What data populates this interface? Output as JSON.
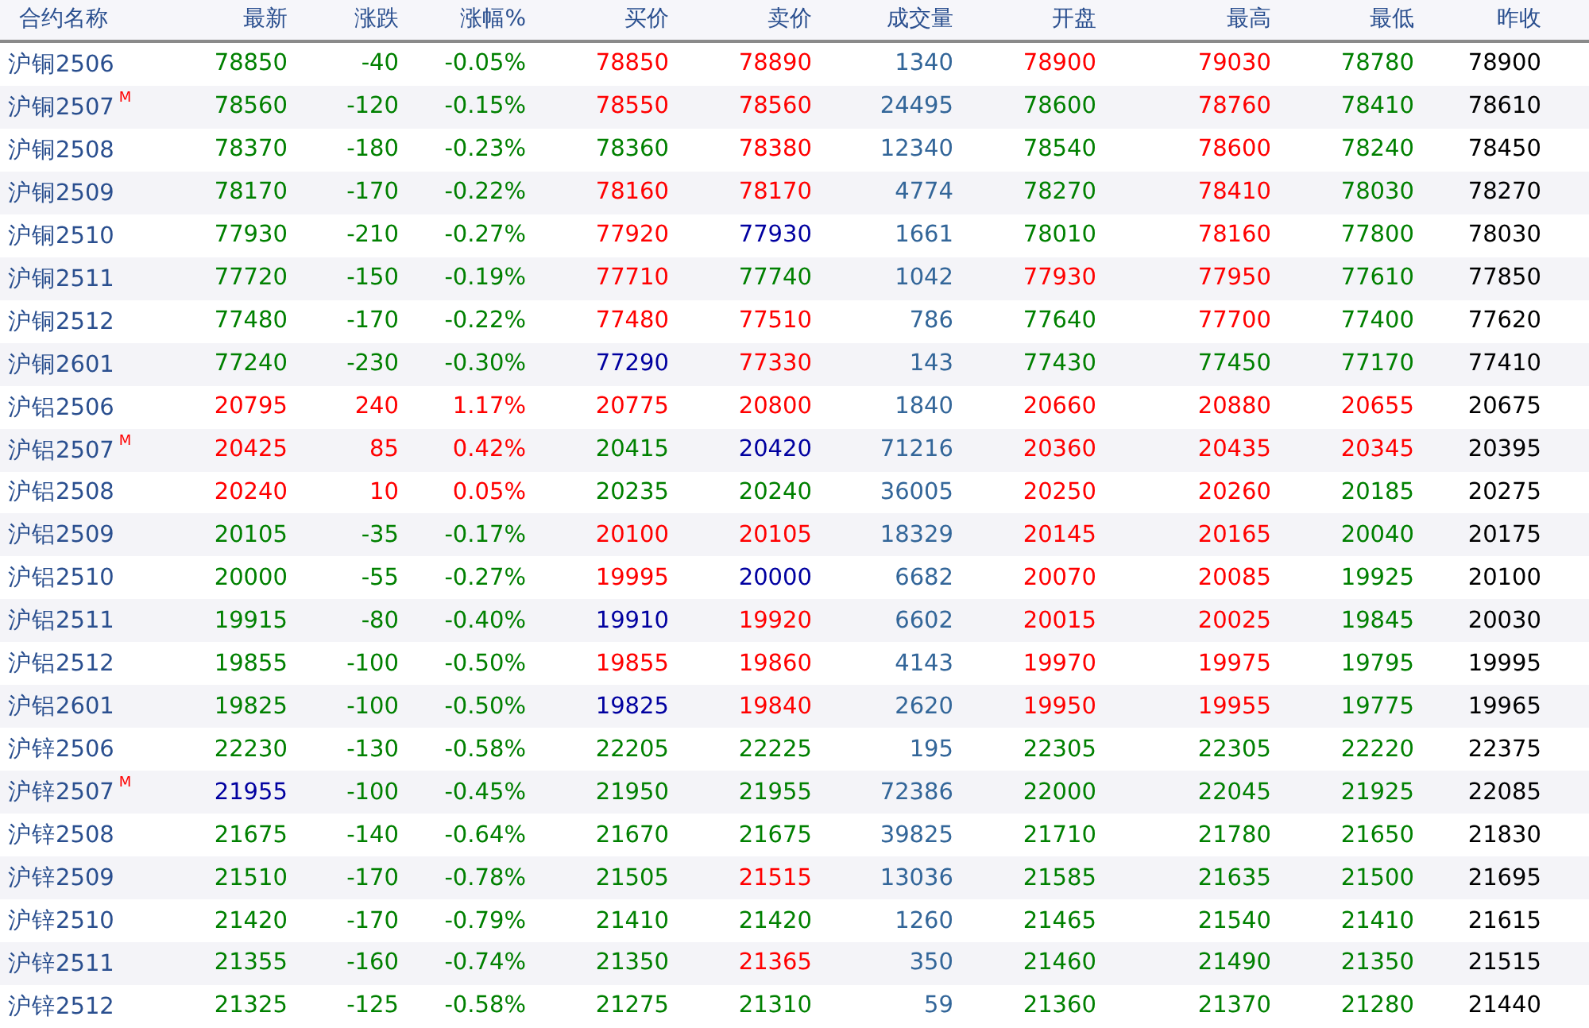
{
  "table": {
    "name_header": "合约名称",
    "columns": [
      "最新",
      "涨跌",
      "涨幅%",
      "买价",
      "卖价",
      "成交量",
      "开盘",
      "最高",
      "最低",
      "昨收"
    ],
    "rows": [
      {
        "name": "沪铜2506",
        "cells": [
          {
            "text": "78850",
            "color": "#008000"
          },
          {
            "text": "-40",
            "color": "#008000"
          },
          {
            "text": "-0.05%",
            "color": "#008000"
          },
          {
            "text": "78850",
            "color": "#ff0000"
          },
          {
            "text": "78890",
            "color": "#ff0000"
          },
          {
            "text": "1340",
            "color": "#336699"
          },
          {
            "text": "78900",
            "color": "#ff0000"
          },
          {
            "text": "79030",
            "color": "#ff0000"
          },
          {
            "text": "78780",
            "color": "#008000"
          },
          {
            "text": "78900",
            "color": "#000000"
          }
        ]
      },
      {
        "name": "沪铜2507",
        "badge": "M",
        "cells": [
          {
            "text": "78560",
            "color": "#008000"
          },
          {
            "text": "-120",
            "color": "#008000"
          },
          {
            "text": "-0.15%",
            "color": "#008000"
          },
          {
            "text": "78550",
            "color": "#ff0000"
          },
          {
            "text": "78560",
            "color": "#ff0000"
          },
          {
            "text": "24495",
            "color": "#336699"
          },
          {
            "text": "78600",
            "color": "#008000"
          },
          {
            "text": "78760",
            "color": "#ff0000"
          },
          {
            "text": "78410",
            "color": "#008000"
          },
          {
            "text": "78610",
            "color": "#000000"
          }
        ]
      },
      {
        "name": "沪铜2508",
        "cells": [
          {
            "text": "78370",
            "color": "#008000"
          },
          {
            "text": "-180",
            "color": "#008000"
          },
          {
            "text": "-0.23%",
            "color": "#008000"
          },
          {
            "text": "78360",
            "color": "#008000"
          },
          {
            "text": "78380",
            "color": "#ff0000"
          },
          {
            "text": "12340",
            "color": "#336699"
          },
          {
            "text": "78540",
            "color": "#008000"
          },
          {
            "text": "78600",
            "color": "#ff0000"
          },
          {
            "text": "78240",
            "color": "#008000"
          },
          {
            "text": "78450",
            "color": "#000000"
          }
        ]
      },
      {
        "name": "沪铜2509",
        "cells": [
          {
            "text": "78170",
            "color": "#008000"
          },
          {
            "text": "-170",
            "color": "#008000"
          },
          {
            "text": "-0.22%",
            "color": "#008000"
          },
          {
            "text": "78160",
            "color": "#ff0000"
          },
          {
            "text": "78170",
            "color": "#ff0000"
          },
          {
            "text": "4774",
            "color": "#336699"
          },
          {
            "text": "78270",
            "color": "#008000"
          },
          {
            "text": "78410",
            "color": "#ff0000"
          },
          {
            "text": "78030",
            "color": "#008000"
          },
          {
            "text": "78270",
            "color": "#000000"
          }
        ]
      },
      {
        "name": "沪铜2510",
        "cells": [
          {
            "text": "77930",
            "color": "#008000"
          },
          {
            "text": "-210",
            "color": "#008000"
          },
          {
            "text": "-0.27%",
            "color": "#008000"
          },
          {
            "text": "77920",
            "color": "#ff0000"
          },
          {
            "text": "77930",
            "color": "#0000a0"
          },
          {
            "text": "1661",
            "color": "#336699"
          },
          {
            "text": "78010",
            "color": "#008000"
          },
          {
            "text": "78160",
            "color": "#ff0000"
          },
          {
            "text": "77800",
            "color": "#008000"
          },
          {
            "text": "78030",
            "color": "#000000"
          }
        ]
      },
      {
        "name": "沪铜2511",
        "cells": [
          {
            "text": "77720",
            "color": "#008000"
          },
          {
            "text": "-150",
            "color": "#008000"
          },
          {
            "text": "-0.19%",
            "color": "#008000"
          },
          {
            "text": "77710",
            "color": "#ff0000"
          },
          {
            "text": "77740",
            "color": "#008000"
          },
          {
            "text": "1042",
            "color": "#336699"
          },
          {
            "text": "77930",
            "color": "#ff0000"
          },
          {
            "text": "77950",
            "color": "#ff0000"
          },
          {
            "text": "77610",
            "color": "#008000"
          },
          {
            "text": "77850",
            "color": "#000000"
          }
        ]
      },
      {
        "name": "沪铜2512",
        "cells": [
          {
            "text": "77480",
            "color": "#008000"
          },
          {
            "text": "-170",
            "color": "#008000"
          },
          {
            "text": "-0.22%",
            "color": "#008000"
          },
          {
            "text": "77480",
            "color": "#ff0000"
          },
          {
            "text": "77510",
            "color": "#ff0000"
          },
          {
            "text": "786",
            "color": "#336699"
          },
          {
            "text": "77640",
            "color": "#008000"
          },
          {
            "text": "77700",
            "color": "#ff0000"
          },
          {
            "text": "77400",
            "color": "#008000"
          },
          {
            "text": "77620",
            "color": "#000000"
          }
        ]
      },
      {
        "name": "沪铜2601",
        "cells": [
          {
            "text": "77240",
            "color": "#008000"
          },
          {
            "text": "-230",
            "color": "#008000"
          },
          {
            "text": "-0.30%",
            "color": "#008000"
          },
          {
            "text": "77290",
            "color": "#0000a0"
          },
          {
            "text": "77330",
            "color": "#ff0000"
          },
          {
            "text": "143",
            "color": "#336699"
          },
          {
            "text": "77430",
            "color": "#008000"
          },
          {
            "text": "77450",
            "color": "#008000"
          },
          {
            "text": "77170",
            "color": "#008000"
          },
          {
            "text": "77410",
            "color": "#000000"
          }
        ]
      },
      {
        "name": "沪铝2506",
        "cells": [
          {
            "text": "20795",
            "color": "#ff0000"
          },
          {
            "text": "240",
            "color": "#ff0000"
          },
          {
            "text": "1.17%",
            "color": "#ff0000"
          },
          {
            "text": "20775",
            "color": "#ff0000"
          },
          {
            "text": "20800",
            "color": "#ff0000"
          },
          {
            "text": "1840",
            "color": "#336699"
          },
          {
            "text": "20660",
            "color": "#ff0000"
          },
          {
            "text": "20880",
            "color": "#ff0000"
          },
          {
            "text": "20655",
            "color": "#ff0000"
          },
          {
            "text": "20675",
            "color": "#000000"
          }
        ]
      },
      {
        "name": "沪铝2507",
        "badge": "M",
        "cells": [
          {
            "text": "20425",
            "color": "#ff0000"
          },
          {
            "text": "85",
            "color": "#ff0000"
          },
          {
            "text": "0.42%",
            "color": "#ff0000"
          },
          {
            "text": "20415",
            "color": "#008000"
          },
          {
            "text": "20420",
            "color": "#0000a0"
          },
          {
            "text": "71216",
            "color": "#336699"
          },
          {
            "text": "20360",
            "color": "#ff0000"
          },
          {
            "text": "20435",
            "color": "#ff0000"
          },
          {
            "text": "20345",
            "color": "#ff0000"
          },
          {
            "text": "20395",
            "color": "#000000"
          }
        ]
      },
      {
        "name": "沪铝2508",
        "cells": [
          {
            "text": "20240",
            "color": "#ff0000"
          },
          {
            "text": "10",
            "color": "#ff0000"
          },
          {
            "text": "0.05%",
            "color": "#ff0000"
          },
          {
            "text": "20235",
            "color": "#008000"
          },
          {
            "text": "20240",
            "color": "#008000"
          },
          {
            "text": "36005",
            "color": "#336699"
          },
          {
            "text": "20250",
            "color": "#ff0000"
          },
          {
            "text": "20260",
            "color": "#ff0000"
          },
          {
            "text": "20185",
            "color": "#008000"
          },
          {
            "text": "20275",
            "color": "#000000"
          }
        ]
      },
      {
        "name": "沪铝2509",
        "cells": [
          {
            "text": "20105",
            "color": "#008000"
          },
          {
            "text": "-35",
            "color": "#008000"
          },
          {
            "text": "-0.17%",
            "color": "#008000"
          },
          {
            "text": "20100",
            "color": "#ff0000"
          },
          {
            "text": "20105",
            "color": "#ff0000"
          },
          {
            "text": "18329",
            "color": "#336699"
          },
          {
            "text": "20145",
            "color": "#ff0000"
          },
          {
            "text": "20165",
            "color": "#ff0000"
          },
          {
            "text": "20040",
            "color": "#008000"
          },
          {
            "text": "20175",
            "color": "#000000"
          }
        ]
      },
      {
        "name": "沪铝2510",
        "cells": [
          {
            "text": "20000",
            "color": "#008000"
          },
          {
            "text": "-55",
            "color": "#008000"
          },
          {
            "text": "-0.27%",
            "color": "#008000"
          },
          {
            "text": "19995",
            "color": "#ff0000"
          },
          {
            "text": "20000",
            "color": "#0000a0"
          },
          {
            "text": "6682",
            "color": "#336699"
          },
          {
            "text": "20070",
            "color": "#ff0000"
          },
          {
            "text": "20085",
            "color": "#ff0000"
          },
          {
            "text": "19925",
            "color": "#008000"
          },
          {
            "text": "20100",
            "color": "#000000"
          }
        ]
      },
      {
        "name": "沪铝2511",
        "cells": [
          {
            "text": "19915",
            "color": "#008000"
          },
          {
            "text": "-80",
            "color": "#008000"
          },
          {
            "text": "-0.40%",
            "color": "#008000"
          },
          {
            "text": "19910",
            "color": "#0000a0"
          },
          {
            "text": "19920",
            "color": "#ff0000"
          },
          {
            "text": "6602",
            "color": "#336699"
          },
          {
            "text": "20015",
            "color": "#ff0000"
          },
          {
            "text": "20025",
            "color": "#ff0000"
          },
          {
            "text": "19845",
            "color": "#008000"
          },
          {
            "text": "20030",
            "color": "#000000"
          }
        ]
      },
      {
        "name": "沪铝2512",
        "cells": [
          {
            "text": "19855",
            "color": "#008000"
          },
          {
            "text": "-100",
            "color": "#008000"
          },
          {
            "text": "-0.50%",
            "color": "#008000"
          },
          {
            "text": "19855",
            "color": "#ff0000"
          },
          {
            "text": "19860",
            "color": "#ff0000"
          },
          {
            "text": "4143",
            "color": "#336699"
          },
          {
            "text": "19970",
            "color": "#ff0000"
          },
          {
            "text": "19975",
            "color": "#ff0000"
          },
          {
            "text": "19795",
            "color": "#008000"
          },
          {
            "text": "19995",
            "color": "#000000"
          }
        ]
      },
      {
        "name": "沪铝2601",
        "cells": [
          {
            "text": "19825",
            "color": "#008000"
          },
          {
            "text": "-100",
            "color": "#008000"
          },
          {
            "text": "-0.50%",
            "color": "#008000"
          },
          {
            "text": "19825",
            "color": "#0000a0"
          },
          {
            "text": "19840",
            "color": "#ff0000"
          },
          {
            "text": "2620",
            "color": "#336699"
          },
          {
            "text": "19950",
            "color": "#ff0000"
          },
          {
            "text": "19955",
            "color": "#ff0000"
          },
          {
            "text": "19775",
            "color": "#008000"
          },
          {
            "text": "19965",
            "color": "#000000"
          }
        ]
      },
      {
        "name": "沪锌2506",
        "cells": [
          {
            "text": "22230",
            "color": "#008000"
          },
          {
            "text": "-130",
            "color": "#008000"
          },
          {
            "text": "-0.58%",
            "color": "#008000"
          },
          {
            "text": "22205",
            "color": "#008000"
          },
          {
            "text": "22225",
            "color": "#008000"
          },
          {
            "text": "195",
            "color": "#336699"
          },
          {
            "text": "22305",
            "color": "#008000"
          },
          {
            "text": "22305",
            "color": "#008000"
          },
          {
            "text": "22220",
            "color": "#008000"
          },
          {
            "text": "22375",
            "color": "#000000"
          }
        ]
      },
      {
        "name": "沪锌2507",
        "badge": "M",
        "cells": [
          {
            "text": "21955",
            "color": "#0000a0"
          },
          {
            "text": "-100",
            "color": "#008000"
          },
          {
            "text": "-0.45%",
            "color": "#008000"
          },
          {
            "text": "21950",
            "color": "#008000"
          },
          {
            "text": "21955",
            "color": "#008000"
          },
          {
            "text": "72386",
            "color": "#336699"
          },
          {
            "text": "22000",
            "color": "#008000"
          },
          {
            "text": "22045",
            "color": "#008000"
          },
          {
            "text": "21925",
            "color": "#008000"
          },
          {
            "text": "22085",
            "color": "#000000"
          }
        ]
      },
      {
        "name": "沪锌2508",
        "cells": [
          {
            "text": "21675",
            "color": "#008000"
          },
          {
            "text": "-140",
            "color": "#008000"
          },
          {
            "text": "-0.64%",
            "color": "#008000"
          },
          {
            "text": "21670",
            "color": "#008000"
          },
          {
            "text": "21675",
            "color": "#008000"
          },
          {
            "text": "39825",
            "color": "#336699"
          },
          {
            "text": "21710",
            "color": "#008000"
          },
          {
            "text": "21780",
            "color": "#008000"
          },
          {
            "text": "21650",
            "color": "#008000"
          },
          {
            "text": "21830",
            "color": "#000000"
          }
        ]
      },
      {
        "name": "沪锌2509",
        "cells": [
          {
            "text": "21510",
            "color": "#008000"
          },
          {
            "text": "-170",
            "color": "#008000"
          },
          {
            "text": "-0.78%",
            "color": "#008000"
          },
          {
            "text": "21505",
            "color": "#008000"
          },
          {
            "text": "21515",
            "color": "#ff0000"
          },
          {
            "text": "13036",
            "color": "#336699"
          },
          {
            "text": "21585",
            "color": "#008000"
          },
          {
            "text": "21635",
            "color": "#008000"
          },
          {
            "text": "21500",
            "color": "#008000"
          },
          {
            "text": "21695",
            "color": "#000000"
          }
        ]
      },
      {
        "name": "沪锌2510",
        "cells": [
          {
            "text": "21420",
            "color": "#008000"
          },
          {
            "text": "-170",
            "color": "#008000"
          },
          {
            "text": "-0.79%",
            "color": "#008000"
          },
          {
            "text": "21410",
            "color": "#008000"
          },
          {
            "text": "21420",
            "color": "#008000"
          },
          {
            "text": "1260",
            "color": "#336699"
          },
          {
            "text": "21465",
            "color": "#008000"
          },
          {
            "text": "21540",
            "color": "#008000"
          },
          {
            "text": "21410",
            "color": "#008000"
          },
          {
            "text": "21615",
            "color": "#000000"
          }
        ]
      },
      {
        "name": "沪锌2511",
        "cells": [
          {
            "text": "21355",
            "color": "#008000"
          },
          {
            "text": "-160",
            "color": "#008000"
          },
          {
            "text": "-0.74%",
            "color": "#008000"
          },
          {
            "text": "21350",
            "color": "#008000"
          },
          {
            "text": "21365",
            "color": "#ff0000"
          },
          {
            "text": "350",
            "color": "#336699"
          },
          {
            "text": "21460",
            "color": "#008000"
          },
          {
            "text": "21490",
            "color": "#008000"
          },
          {
            "text": "21350",
            "color": "#008000"
          },
          {
            "text": "21515",
            "color": "#000000"
          }
        ]
      },
      {
        "name": "沪锌2512",
        "cells": [
          {
            "text": "21325",
            "color": "#008000"
          },
          {
            "text": "-125",
            "color": "#008000"
          },
          {
            "text": "-0.58%",
            "color": "#008000"
          },
          {
            "text": "21275",
            "color": "#008000"
          },
          {
            "text": "21310",
            "color": "#008000"
          },
          {
            "text": "59",
            "color": "#336699"
          },
          {
            "text": "21360",
            "color": "#008000"
          },
          {
            "text": "21370",
            "color": "#008000"
          },
          {
            "text": "21280",
            "color": "#008000"
          },
          {
            "text": "21440",
            "color": "#000000"
          }
        ]
      }
    ]
  }
}
